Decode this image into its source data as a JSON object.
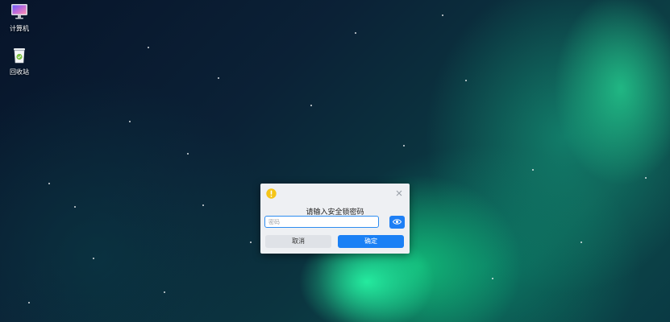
{
  "desktop": {
    "icons": [
      {
        "label": "计算机",
        "icon": "computer-icon"
      },
      {
        "label": "回收站",
        "icon": "trash-icon"
      }
    ]
  },
  "dialog": {
    "icon": "warning-icon",
    "title": "请输入安全锁密码",
    "password": {
      "value": "",
      "placeholder": "密码"
    },
    "show_password_icon": "eye-icon",
    "cancel_label": "取消",
    "confirm_label": "确定",
    "colors": {
      "accent": "#1a80f5",
      "warning": "#f5c518"
    }
  }
}
